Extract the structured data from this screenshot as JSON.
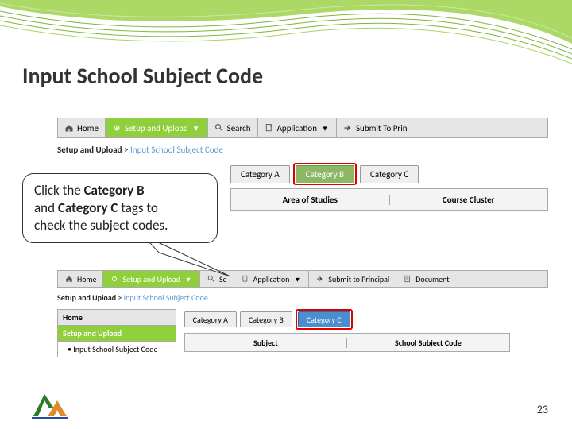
{
  "slide": {
    "title": "Input School Subject Code",
    "page_number": "23"
  },
  "callout": {
    "line1_pre": "Click the ",
    "line1_bold": "Category B",
    "line2_pre": "and ",
    "line2_bold": "Category C",
    "line2_post": " tags to",
    "line3": "check the subject codes."
  },
  "panel1": {
    "nav": {
      "home": "Home",
      "setup": "Setup and Upload",
      "search": "Search",
      "application": "Application",
      "submit": "Submit To Prin"
    },
    "breadcrumb": {
      "root": "Setup and Upload",
      "sep": ">",
      "current": "Input School Subject Code"
    },
    "tabs": {
      "a": "Category A",
      "b": "Category B",
      "c": "Category C"
    },
    "columns": {
      "col1": "Area of Studies",
      "col2": "Course Cluster"
    }
  },
  "panel2": {
    "nav": {
      "home": "Home",
      "setup": "Setup and Upload",
      "search": "Se",
      "application": "Application",
      "submit": "Submit to Principal",
      "document": "Document"
    },
    "breadcrumb": {
      "root": "Setup and Upload",
      "sep": ">",
      "current": "Input School Subject Code"
    },
    "sidebar": {
      "home": "Home",
      "setup": "Setup and Upload",
      "item1": "Input School Subject Code"
    },
    "tabs": {
      "a": "Category A",
      "b": "Category B",
      "c": "Category C"
    },
    "columns": {
      "col1": "Subject",
      "col2": "School Subject Code"
    }
  }
}
